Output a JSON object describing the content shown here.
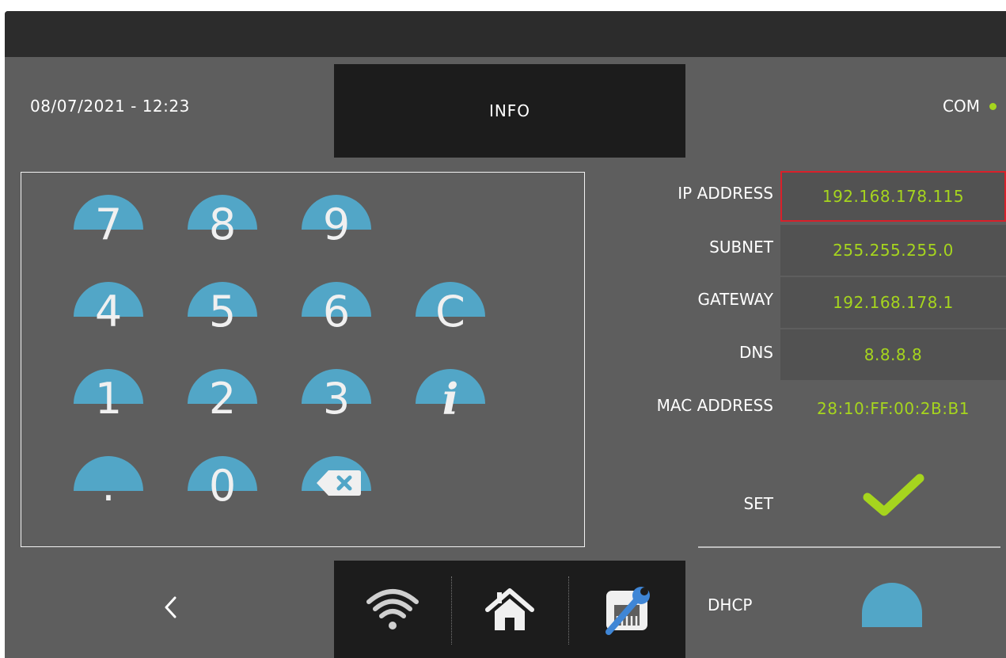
{
  "header": {
    "datetime": "08/07/2021 - 12:23",
    "title": "INFO",
    "com_label": "COM",
    "com_status_color": "#a6d51e"
  },
  "keypad": {
    "keys": [
      "7",
      "8",
      "9",
      "4",
      "5",
      "6",
      "C",
      "1",
      "2",
      "3",
      "i",
      ".",
      "0",
      "backspace-icon"
    ],
    "key_color": "#52a6c7"
  },
  "network": {
    "ip_label": "IP ADDRESS",
    "ip_value": "192.168.178.115",
    "subnet_label": "SUBNET",
    "subnet_value": "255.255.255.0",
    "gateway_label": "GATEWAY",
    "gateway_value": "192.168.178.1",
    "dns_label": "DNS",
    "dns_value": "8.8.8.8",
    "mac_label": "MAC ADDRESS",
    "mac_value": "28:10:FF:00:2B:B1",
    "value_color": "#a6d51e",
    "selected_border_color": "#d9202a"
  },
  "actions": {
    "set_label": "SET",
    "set_icon": "checkmark-icon",
    "dhcp_label": "DHCP"
  },
  "nav": {
    "back_glyph": "‹",
    "items": [
      "wifi-icon",
      "home-icon",
      "settings-wrench-icon"
    ]
  }
}
